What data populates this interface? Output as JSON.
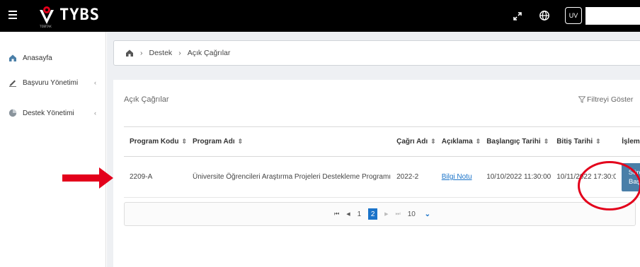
{
  "topbar": {
    "logo_text": "TYBS",
    "logo_sub": "TÜBİTAK",
    "icons": [
      "menu-icon",
      "expand-icon",
      "globe-icon"
    ],
    "user_initials": "UV",
    "search_value": ""
  },
  "sidebar": {
    "items": [
      {
        "label": "Anasayfa",
        "icon": "home-icon",
        "has_submenu": false
      },
      {
        "label": "Başvuru Yönetimi",
        "icon": "pencil-icon",
        "has_submenu": true,
        "chevron": "‹"
      },
      {
        "label": "Destek Yönetimi",
        "icon": "pie-chart-icon",
        "has_submenu": true,
        "chevron": "‹"
      }
    ]
  },
  "breadcrumb": {
    "items": [
      "Destek",
      "Açık Çağrılar"
    ],
    "separator": "›"
  },
  "panel": {
    "title": "Açık Çağrılar",
    "filter_label": "Filtreyi Göster"
  },
  "table": {
    "columns": [
      "Program Kodu",
      "Program Adı",
      "Çağrı Adı",
      "Açıklama",
      "Başlangıç Tarihi",
      "Bitiş Tarihi",
      "İşlem"
    ],
    "sort_glyph": "⇕",
    "rows": [
      {
        "program_kodu": "2209-A",
        "program_adi": "Üniversite Öğrencileri Araştırma Projeleri Destekleme Programı",
        "cagri_adi": "2022-2",
        "aciklama": "Bilgi Notu",
        "baslangic": "10/10/2022 11:30:00",
        "bitis": "10/11/2022 17:30:0",
        "action_line1": "Süreci",
        "action_line2": "Başlat"
      }
    ]
  },
  "pager": {
    "first": "⏮",
    "prev": "◀",
    "pages": [
      "1",
      "2"
    ],
    "current_page": "2",
    "next": "▶",
    "last": "⏭",
    "page_size": "10",
    "page_size_chevron": "⌄"
  },
  "annotations": {
    "arrow_color": "#e3001b",
    "circle_color": "#e3001b"
  },
  "colors": {
    "topbar": "#000000",
    "action_button": "#4a7fa8",
    "link": "#1a73c9",
    "page_active": "#1a73c9"
  }
}
